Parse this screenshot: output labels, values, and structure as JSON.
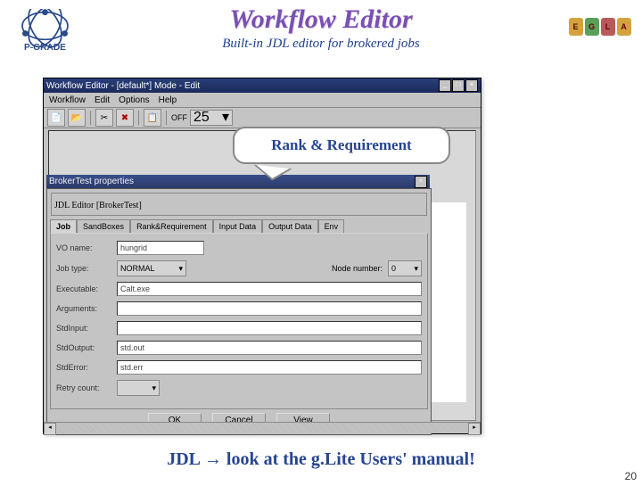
{
  "slide": {
    "title": "Workflow Editor",
    "subtitle": "Built-in JDL editor for brokered jobs",
    "footer": "JDL → look at the g.Lite Users' manual!",
    "page_number": "20"
  },
  "callout": {
    "text": "Rank & Requirement"
  },
  "logo_left": "P-GRADE",
  "window": {
    "title": "Workflow Editor - [default*] Mode - Edit",
    "menu": [
      "Workflow",
      "Edit",
      "Options",
      "Help"
    ],
    "toolbar_off": "OFF",
    "toolbar_zoom": "25",
    "close": "×",
    "min": "_",
    "max": "□"
  },
  "dialog": {
    "title": "BrokerTest properties",
    "panel_title": "JDL Editor  [BrokerTest]",
    "close": "×",
    "tabs": [
      "Job",
      "SandBoxes",
      "Rank&Requirement",
      "Input Data",
      "Output Data",
      "Env"
    ],
    "form": {
      "vo_label": "VO name:",
      "vo_value": "hungrid",
      "jt_label": "Job type:",
      "jt_value": "NORMAL",
      "nn_label": "Node number:",
      "nn_value": "0",
      "ex_label": "Executable:",
      "ex_value": "Calt.exe",
      "ar_label": "Arguments:",
      "ar_value": "",
      "si_label": "StdInput:",
      "si_value": "",
      "so_label": "StdOutput:",
      "so_value": "std.out",
      "se_label": "StdError:",
      "se_value": "std.err",
      "rc_label": "Retry count:",
      "rc_value": ""
    },
    "buttons": {
      "ok": "OK",
      "cancel": "Cancel",
      "view": "View"
    }
  }
}
